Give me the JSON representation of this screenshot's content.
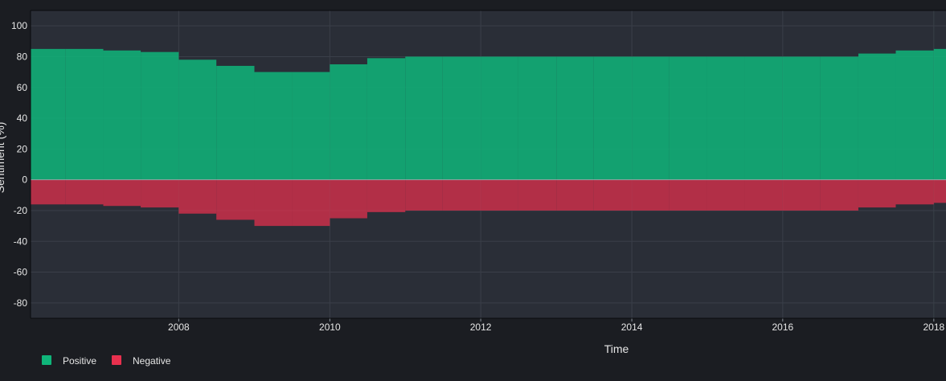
{
  "chart_data": {
    "type": "bar",
    "xlabel": "Time",
    "ylabel": "Sentiment (%)",
    "xlim": [
      "2006-01-14",
      "2018-03-01"
    ],
    "ylim": [
      -90,
      110
    ],
    "grid": true,
    "x_ticks": [
      "2008",
      "2010",
      "2012",
      "2014",
      "2016",
      "2018"
    ],
    "y_ticks": [
      -80,
      -60,
      -40,
      -20,
      0,
      20,
      40,
      60,
      80,
      100
    ],
    "legend": {
      "placement": "bottom-left"
    },
    "series": [
      {
        "name": "Positive",
        "color": "#0fb57a",
        "x": [
          "2006-01",
          "2006-07",
          "2007-01",
          "2007-07",
          "2008-01",
          "2008-07",
          "2009-01",
          "2009-07",
          "2010-01",
          "2010-07",
          "2011-01",
          "2011-07",
          "2012-01",
          "2012-07",
          "2013-01",
          "2013-07",
          "2014-01",
          "2014-07",
          "2015-01",
          "2015-07",
          "2016-01",
          "2016-07",
          "2017-01",
          "2017-07",
          "2018-01"
        ],
        "values": [
          85,
          85,
          84,
          83,
          78,
          74,
          70,
          70,
          75,
          79,
          80,
          80,
          80,
          80,
          80,
          80,
          80,
          80,
          80,
          80,
          80,
          80,
          82,
          84,
          85
        ]
      },
      {
        "name": "Negative",
        "color": "#e8304e",
        "x": [
          "2006-01",
          "2006-07",
          "2007-01",
          "2007-07",
          "2008-01",
          "2008-07",
          "2009-01",
          "2009-07",
          "2010-01",
          "2010-07",
          "2011-01",
          "2011-07",
          "2012-01",
          "2012-07",
          "2013-01",
          "2013-07",
          "2014-01",
          "2014-07",
          "2015-01",
          "2015-07",
          "2016-01",
          "2016-07",
          "2017-01",
          "2017-07",
          "2018-01"
        ],
        "values": [
          -16,
          -16,
          -17,
          -18,
          -22,
          -26,
          -30,
          -30,
          -25,
          -21,
          -20,
          -20,
          -20,
          -20,
          -20,
          -20,
          -20,
          -20,
          -20,
          -20,
          -20,
          -20,
          -18,
          -16,
          -15
        ]
      }
    ]
  }
}
